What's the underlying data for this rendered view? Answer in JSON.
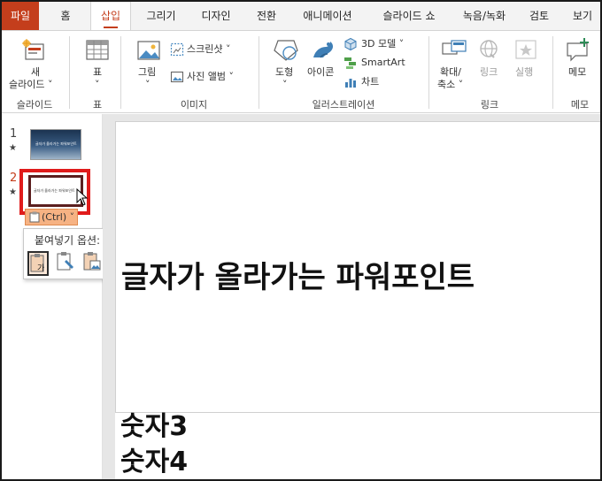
{
  "tabs": [
    {
      "label": "파일",
      "kind": "file"
    },
    {
      "label": "홈"
    },
    {
      "label": "삽입",
      "active": true
    },
    {
      "label": "그리기"
    },
    {
      "label": "디자인"
    },
    {
      "label": "전환"
    },
    {
      "label": "애니메이션"
    },
    {
      "label": "슬라이드 쇼"
    },
    {
      "label": "녹음/녹화"
    },
    {
      "label": "검토"
    },
    {
      "label": "보기"
    }
  ],
  "ribbon": {
    "groups": {
      "slides": "슬라이드",
      "table": "표",
      "images": "이미지",
      "illustrations": "일러스트레이션",
      "links": "링크",
      "comments": "메모"
    },
    "new_slide": {
      "line1": "새",
      "line2": "슬라이드 ˅"
    },
    "table_btn": "표",
    "table_chev": "˅",
    "pictures": "그림",
    "pictures_chev": "˅",
    "screenshot": "스크린샷 ˅",
    "photo_album": "사진 앨범 ˅",
    "shapes": "도형",
    "shapes_chev": "˅",
    "icons": "아이콘",
    "model3d": "3D 모델 ˅",
    "smartart": "SmartArt",
    "chart": "차트",
    "zoom": {
      "line1": "확대/",
      "line2": "축소 ˅"
    },
    "link": "링크",
    "action": "실행",
    "comment": "메모"
  },
  "thumbnails": [
    {
      "number": "1",
      "star": "★",
      "text": "글자가 올라가는 파워포인트"
    },
    {
      "number": "2",
      "star": "★",
      "text": "글자가 올라가는 파워포인트"
    }
  ],
  "paste": {
    "ctrl_label": "(Ctrl) ˅",
    "title": "붙여넣기 옵션:"
  },
  "slide": {
    "title": "글자가 올라가는 파워포인트",
    "overflow": [
      "숫자3",
      "숫자4"
    ]
  },
  "colors": {
    "accent": "#c43e1c",
    "highlight": "#e01b1b"
  }
}
